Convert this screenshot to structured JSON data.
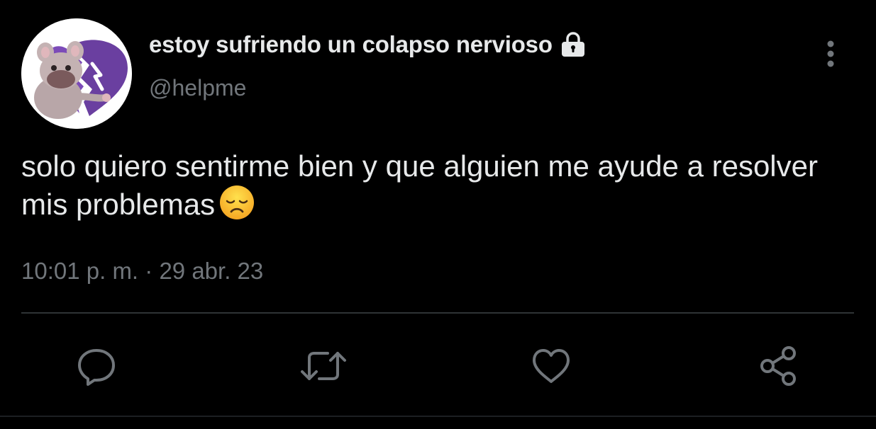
{
  "tweet": {
    "display_name": "estoy sufriendo un colapso nervioso",
    "handle": "@helpme",
    "text": "solo quiero sentirme bien y que alguien me ayude a resolver mis problemas",
    "emoji": "disappointed-face",
    "time": "10:01 p. m.",
    "separator": "·",
    "date": "29 abr. 23",
    "protected_icon": "lock-icon",
    "avatar_icon": "cartoon-mouse-broken-heart"
  },
  "actions": [
    {
      "name": "reply",
      "icon": "comment-icon"
    },
    {
      "name": "retweet",
      "icon": "retweet-icon"
    },
    {
      "name": "like",
      "icon": "heart-icon"
    },
    {
      "name": "share",
      "icon": "share-icon"
    }
  ],
  "colors": {
    "background": "#000000",
    "primary_text": "#e7e9ea",
    "secondary_text": "#71767b",
    "divider": "#2f3336",
    "avatar_heart": "#6a3fa0"
  }
}
